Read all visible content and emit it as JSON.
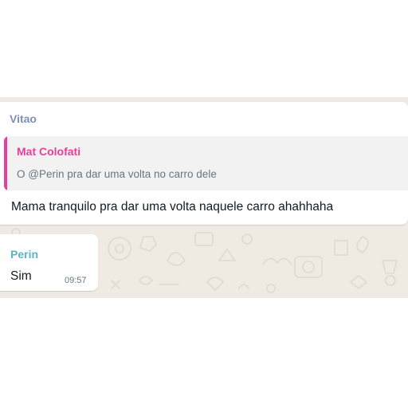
{
  "colors": {
    "chat_background": "#efeae2",
    "bubble": "#ffffff",
    "sender_vitao": "#7f8fb4",
    "sender_perin": "#5ab4c4",
    "quote_author": "#e6409a",
    "quote_bar": "#e6409a"
  },
  "messages": [
    {
      "sender": "Vitao",
      "quote": {
        "author": "Mat Colofati",
        "text": "O @Perin pra dar uma volta no carro dele"
      },
      "text": "Mama tranquilo pra dar uma volta naquele carro ahahhaha"
    },
    {
      "sender": "Perin",
      "text": "Sim",
      "time": "09:57"
    }
  ],
  "wallpaper_icon": "doodle-pattern"
}
